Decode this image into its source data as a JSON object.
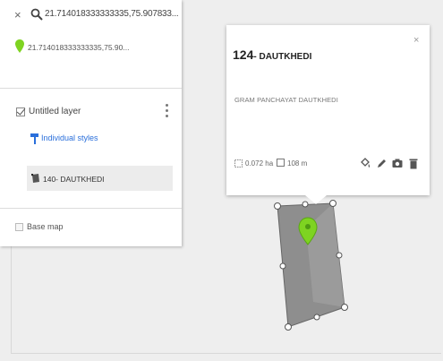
{
  "search": {
    "close_symbol": "×",
    "query": "21.714018333333335,75.907833..."
  },
  "result": {
    "text": "21.714018333333335,75.90..."
  },
  "layer": {
    "title": "Untitled layer",
    "styles_link": "Individual styles",
    "feature_label": "140- DAUTKHEDI"
  },
  "basemap": {
    "label": "Base map"
  },
  "popup": {
    "title_number": "124",
    "title_name": "- DAUTKHEDI",
    "close_symbol": "×",
    "description": "GRAM PANCHAYAT DAUTKHEDI",
    "area": "0.072 ha",
    "perimeter": "108 m"
  },
  "colors": {
    "pin_green": "#7ed321",
    "link_blue": "#2a6fdb",
    "polygon_fill": "#8e8e8e"
  },
  "icons": {
    "search": "search-icon",
    "pin": "map-pin-icon",
    "styles": "paint-roller-icon",
    "feature": "polygon-icon",
    "style_tool": "paint-bucket-icon",
    "edit_tool": "pencil-icon",
    "photo_tool": "camera-icon",
    "delete_tool": "trash-icon"
  }
}
